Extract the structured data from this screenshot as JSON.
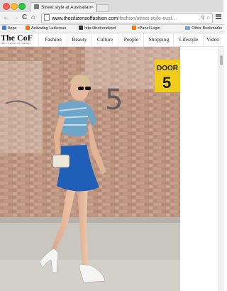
{
  "browser": {
    "tab_title": "Street style at Australian F",
    "tab_close": "×",
    "url_domain": "www.thecitizensoffashion.com",
    "url_path": "/fashion/street-style-aust…",
    "back": "←",
    "forward": "→",
    "reload": "C",
    "home": "⌂",
    "omni_icons": "⚲ ☆",
    "bookmarks": [
      {
        "label": "Apps",
        "color": "#4a7bd6"
      },
      {
        "label": "Activating Ludicrous",
        "color": "#e2742b"
      },
      {
        "label": "http://thetrendspot",
        "color": "#333333"
      },
      {
        "label": "cPanel Login",
        "color": "#f07c1e"
      }
    ],
    "other_bookmarks": "Other Bookmarks"
  },
  "site": {
    "logo": "The CoF",
    "logo_sub": "THE CITIZENS OF FASHION",
    "nav": [
      "Fashion",
      "Beauty",
      "Culture",
      "People",
      "Shopping",
      "Lifestyle",
      "Video"
    ]
  },
  "photo": {
    "door_sign_line1": "DOOR",
    "door_sign_line2": "5",
    "wall_number": "5",
    "colors": {
      "brick": "#b0836c",
      "sign": "#f2cc1a",
      "skirt": "#1f5fb8",
      "pavement": "#c9c6c0"
    }
  }
}
